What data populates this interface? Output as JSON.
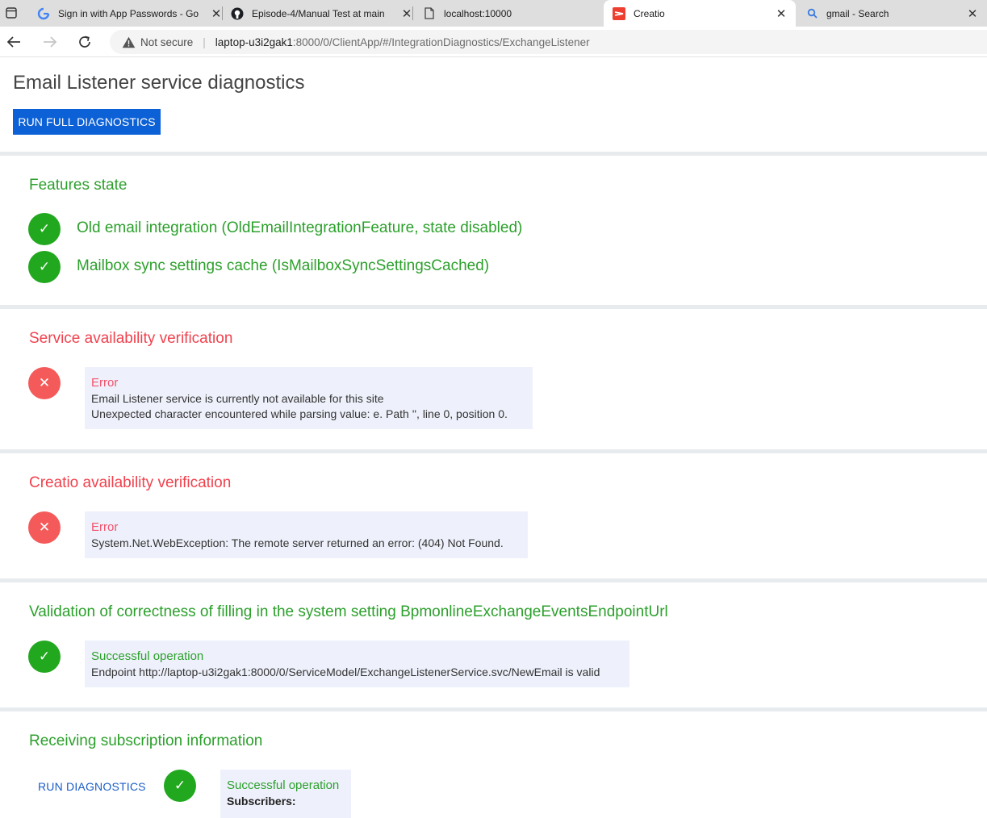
{
  "browser": {
    "tabs": [
      {
        "title": "Sign in with App Passwords - Go",
        "favicon": "google-icon"
      },
      {
        "title": "Episode-4/Manual Test at main",
        "favicon": "github-icon"
      },
      {
        "title": "localhost:10000",
        "favicon": "page-icon"
      },
      {
        "title": "Creatio",
        "favicon": "creatio-icon",
        "active": true
      },
      {
        "title": "gmail - Search",
        "favicon": "search-icon"
      }
    ],
    "address": {
      "security": "Not secure",
      "host": "laptop-u3i2gak1",
      "path": ":8000/0/ClientApp/#/IntegrationDiagnostics/ExchangeListener"
    }
  },
  "page": {
    "title": "Email Listener service diagnostics",
    "run_full_label": "RUN FULL DIAGNOSTICS"
  },
  "sections": {
    "features": {
      "title": "Features state",
      "items": [
        {
          "label": "Old email integration (OldEmailIntegrationFeature, state disabled)",
          "status": "ok"
        },
        {
          "label": "Mailbox sync settings cache (IsMailboxSyncSettingsCached)",
          "status": "ok"
        }
      ]
    },
    "service": {
      "title": "Service availability verification",
      "status": "error",
      "heading": "Error",
      "line1": "Email Listener service is currently not available for this site",
      "line2": "Unexpected character encountered while parsing value: e. Path '', line 0, position 0."
    },
    "creatio": {
      "title": "Creatio availability verification",
      "status": "error",
      "heading": "Error",
      "line1": "System.Net.WebException: The remote server returned an error: (404) Not Found."
    },
    "validation": {
      "title": "Validation of correctness of filling in the system setting BpmonlineExchangeEventsEndpointUrl",
      "status": "ok",
      "heading": "Successful operation",
      "line1": "Endpoint http://laptop-u3i2gak1:8000/0/ServiceModel/ExchangeListenerService.svc/NewEmail is valid"
    },
    "subscription": {
      "title": "Receiving subscription information",
      "run_label": "RUN DIAGNOSTICS",
      "status": "ok",
      "heading": "Successful operation",
      "subscribers_label": "Subscribers:"
    }
  },
  "colors": {
    "primary_button": "#0d61d6",
    "success": "#22a81f",
    "error": "#f55a5a",
    "success_text": "#2ca02c",
    "error_text": "#f0424e",
    "message_bg": "#eef1fb",
    "divider": "#e8ebee"
  }
}
